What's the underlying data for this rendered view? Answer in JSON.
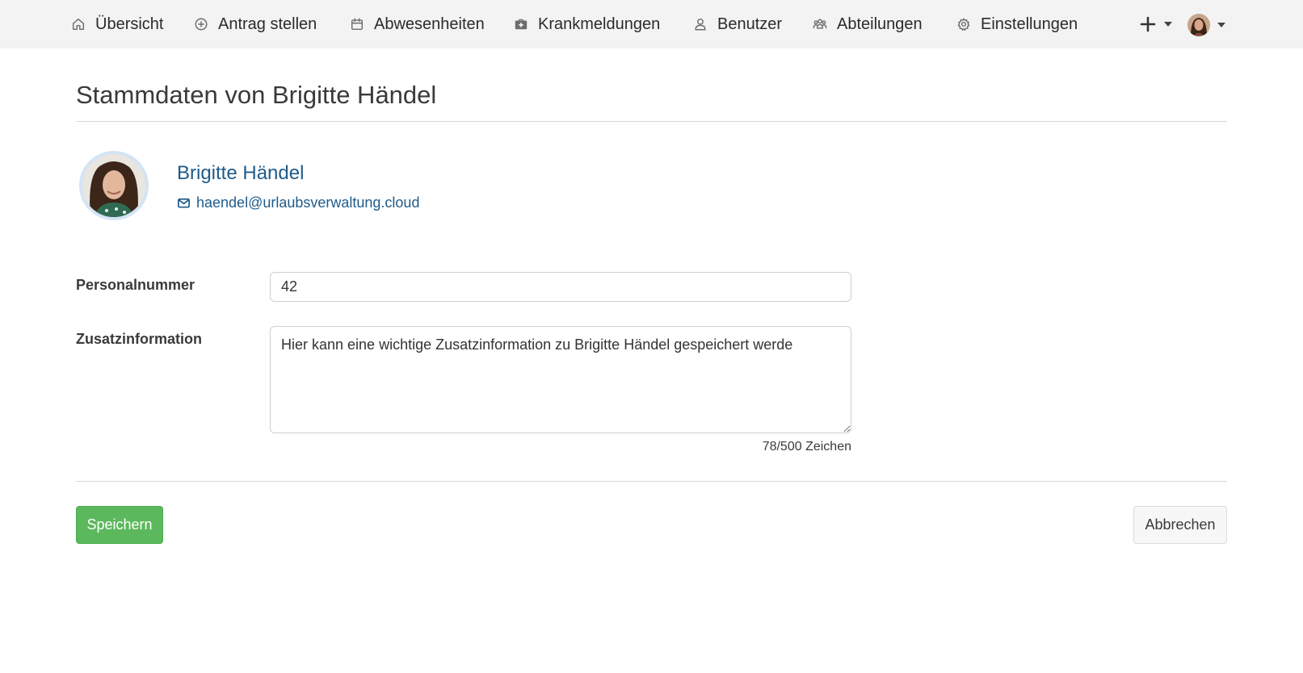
{
  "nav": {
    "items": [
      {
        "label": "Übersicht",
        "icon": "home-icon"
      },
      {
        "label": "Antrag stellen",
        "icon": "plus-circle-icon"
      },
      {
        "label": "Abwesenheiten",
        "icon": "calendar-icon"
      },
      {
        "label": "Krankmeldungen",
        "icon": "medical-kit-icon"
      },
      {
        "label": "Benutzer",
        "icon": "user-icon"
      },
      {
        "label": "Abteilungen",
        "icon": "users-group-icon"
      },
      {
        "label": "Einstellungen",
        "icon": "gear-icon"
      }
    ],
    "quick_add_icon": "plus-icon",
    "user_menu_icon": "avatar"
  },
  "page": {
    "title": "Stammdaten von Brigitte Händel"
  },
  "profile": {
    "name": "Brigitte Händel",
    "email": "haendel@urlaubsverwaltung.cloud",
    "email_icon": "mail-icon"
  },
  "form": {
    "personnel_number_label": "Personalnummer",
    "personnel_number_value": "42",
    "additional_info_label": "Zusatzinformation",
    "additional_info_value": "Hier kann eine wichtige Zusatzinformation zu Brigitte Händel gespeichert werde",
    "char_count": "78/500 Zeichen"
  },
  "actions": {
    "save_label": "Speichern",
    "cancel_label": "Abbrechen"
  },
  "colors": {
    "navbar_bg": "#f3f3f3",
    "link": "#1f5b8a",
    "save_button": "#5cb85c",
    "cancel_button": "#f7f7f7"
  }
}
